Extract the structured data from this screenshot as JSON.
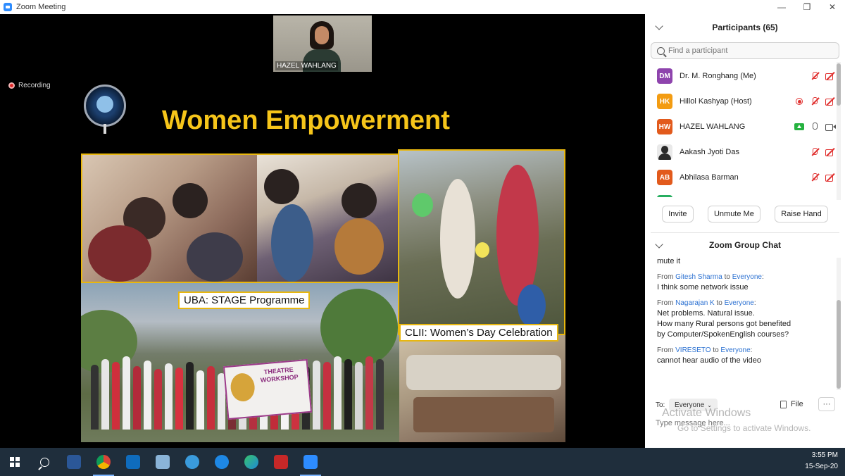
{
  "window": {
    "title": "Zoom Meeting",
    "minimize": "—",
    "restore": "❐",
    "close": "✕"
  },
  "video": {
    "speaker_name": "HAZEL WAHLANG",
    "recording_label": "Recording"
  },
  "slide": {
    "title": "Women Empowerment",
    "caption_left": "UBA: STAGE Programme",
    "caption_right": "CLII: Women’s Day Celebration",
    "banner_text": "THEATRE WORKSHOP"
  },
  "participants": {
    "header": "Participants (65)",
    "search_placeholder": "Find a participant",
    "items": [
      {
        "initials": "DM",
        "name": "Dr. M. Ronghang (Me)",
        "color": "#8e44ad",
        "mic": "muted",
        "cam": "muted"
      },
      {
        "initials": "HK",
        "name": "Hillol Kashyap (Host)",
        "color": "#f39c12",
        "mic": "muted",
        "cam": "muted",
        "recording": true
      },
      {
        "initials": "HW",
        "name": "HAZEL WAHLANG",
        "color": "#e25a1c",
        "mic": "on",
        "cam": "on",
        "sharing": true
      },
      {
        "initials": "",
        "name": "Aakash Jyoti Das",
        "color": "#2b2b2b",
        "mic": "muted",
        "cam": "muted"
      },
      {
        "initials": "AB",
        "name": "Abhilasa Barman",
        "color": "#e25a1c",
        "mic": "muted",
        "cam": "muted"
      }
    ],
    "buttons": {
      "invite": "Invite",
      "unmute": "Unmute Me",
      "raise_hand": "Raise Hand"
    }
  },
  "chat": {
    "header": "Zoom Group Chat",
    "messages": [
      {
        "from": "",
        "to": "",
        "lines": [
          "mute it"
        ]
      },
      {
        "from": "Gitesh Sharma",
        "to": "Everyone",
        "lines": [
          "I think some network issue"
        ]
      },
      {
        "from": "Nagarajan K",
        "to": "Everyone",
        "lines": [
          "Net problems. Natural issue.",
          "How many Rural persons got benefited",
          "by Computer/SpokenEnglish courses?"
        ]
      },
      {
        "from": "VIRESETO",
        "to": "Everyone",
        "lines": [
          "cannot hear audio of the video"
        ]
      }
    ],
    "from_word": "From",
    "to_word": "to",
    "to_label": "To:",
    "to_value": "Everyone",
    "file_label": "File",
    "more_label": "···",
    "input_placeholder": "Type message here...",
    "watermark_line1": "Activate Windows",
    "watermark_line2": "Go to Settings to activate Windows."
  },
  "taskbar": {
    "time": "3:55 PM",
    "date": "15-Sep-20"
  }
}
